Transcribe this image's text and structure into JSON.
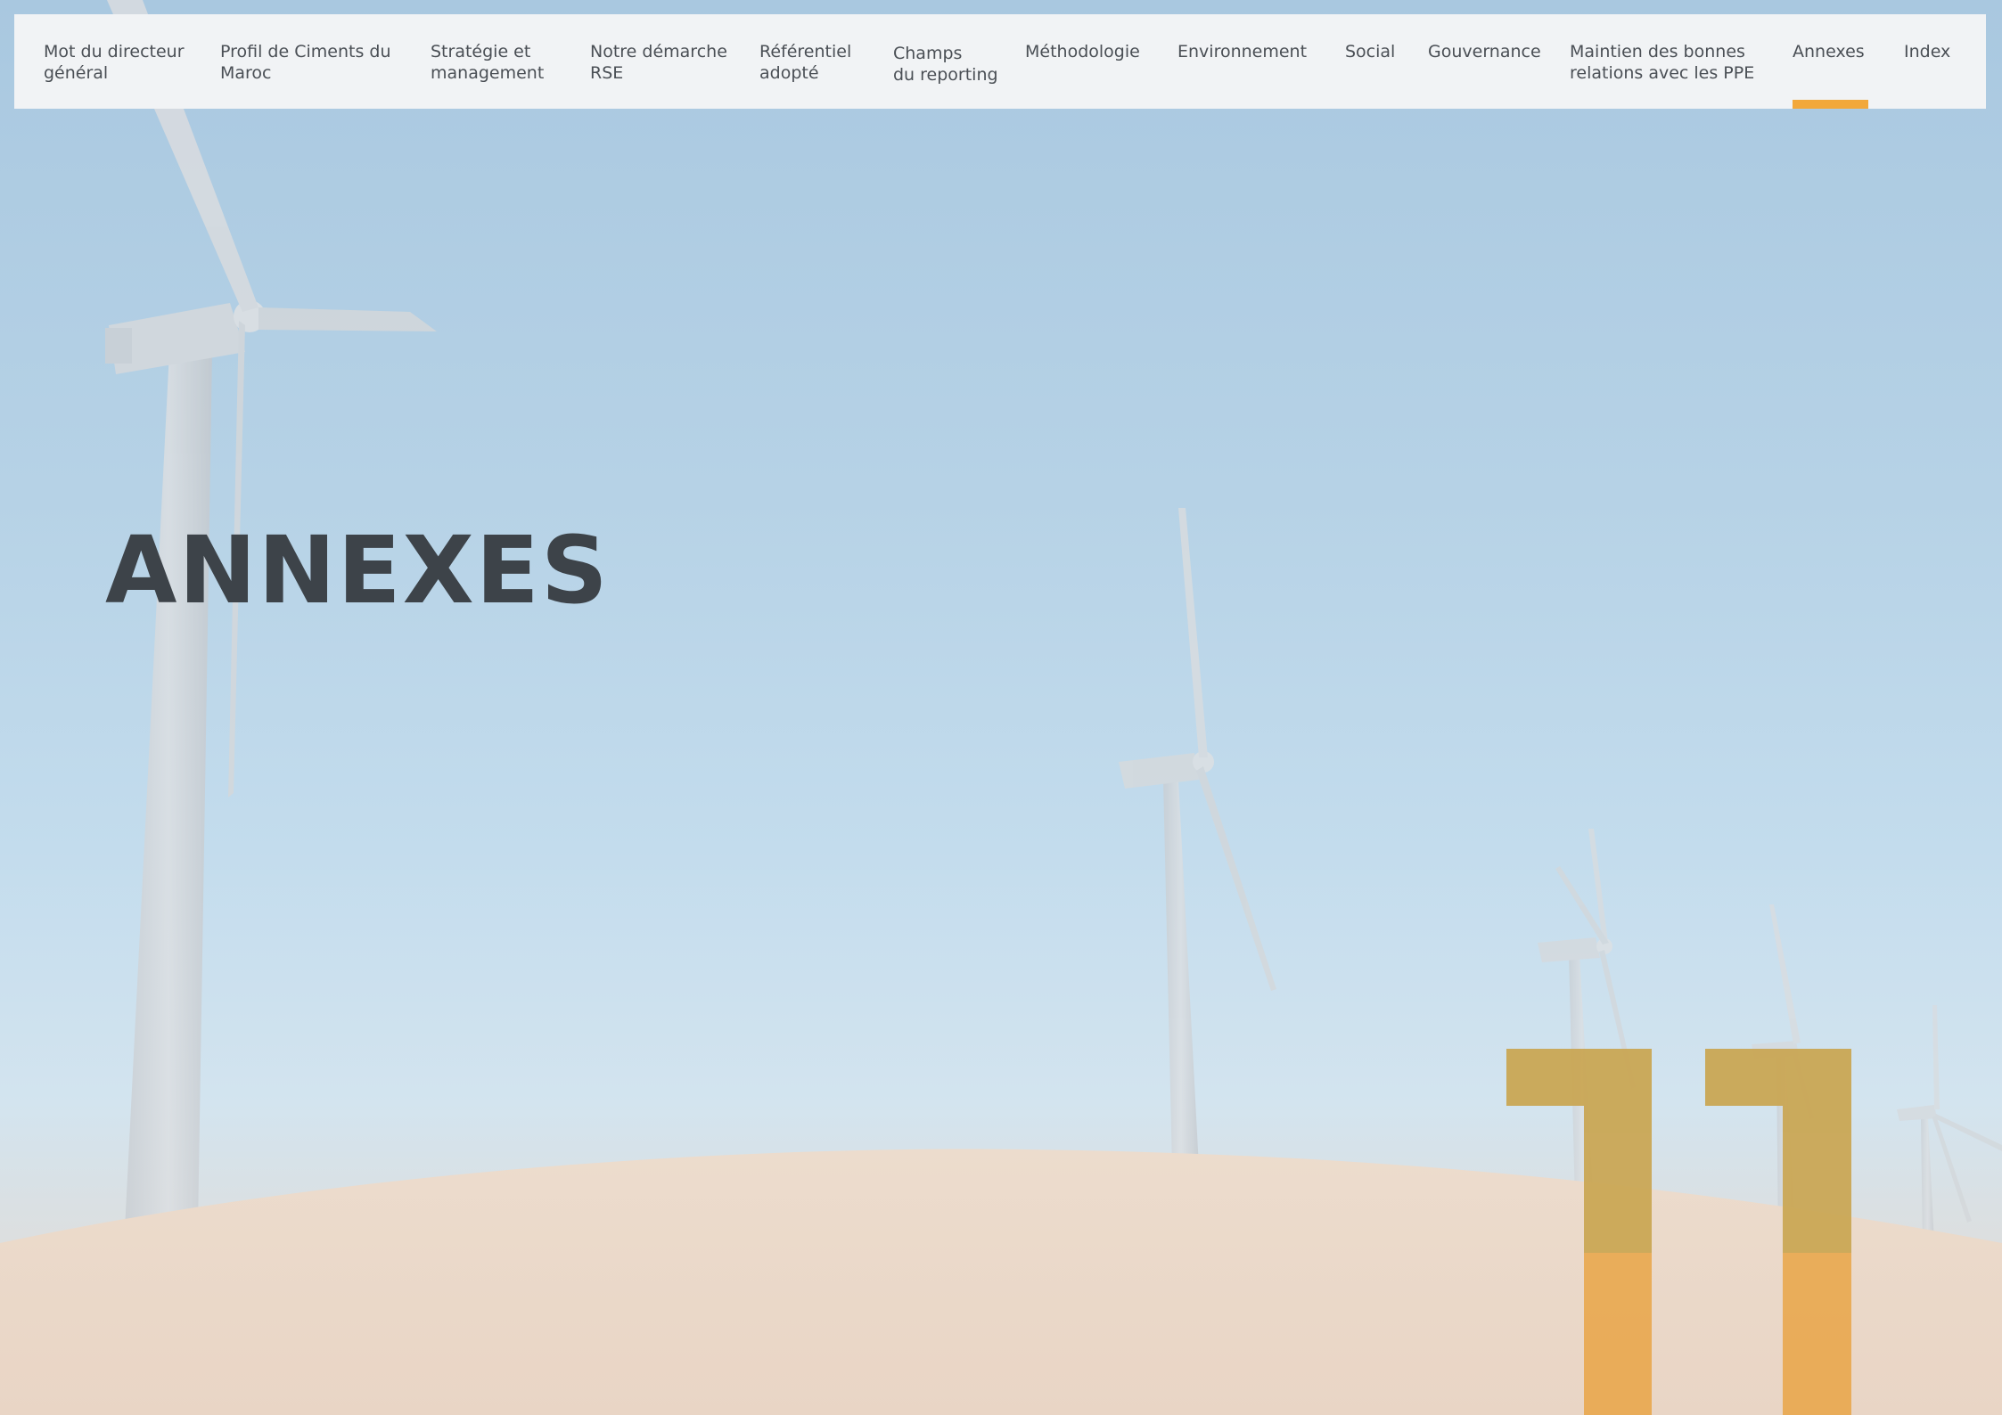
{
  "nav": {
    "items": [
      {
        "label": "Mot du directeur\ngénéral"
      },
      {
        "label": "Profil de Ciments du\nMaroc"
      },
      {
        "label": "Stratégie et\nmanagement"
      },
      {
        "label": "Notre démarche\nRSE"
      },
      {
        "label": "Référentiel\nadopté"
      },
      {
        "label": "Champs\ndu reporting"
      },
      {
        "label": "Méthodologie"
      },
      {
        "label": "Environnement"
      },
      {
        "label": "Social"
      },
      {
        "label": "Gouvernance"
      },
      {
        "label": "Maintien des bonnes\nrelations avec les PPE"
      },
      {
        "label": "Annexes"
      },
      {
        "label": "Index"
      }
    ],
    "active": "Annexes",
    "accent_color": "#f2a83a"
  },
  "page": {
    "title": "ANNEXES",
    "chapter_number": "11",
    "chapter_number_color": "#e8a64a",
    "background": "wind-turbines-desert-photo"
  }
}
